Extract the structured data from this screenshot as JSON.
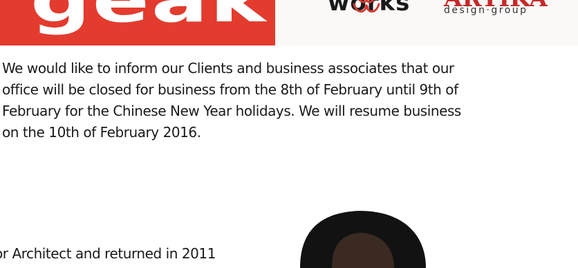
{
  "banner": {
    "left_text": "geak",
    "right_logo_text": "works",
    "right_logo_brand": "ARTIKA",
    "right_logo_subtitle": "design·group",
    "colors": {
      "left_bg": "#e33b2e",
      "right_bg": "#fbf9f7",
      "brand_red": "#c62a2a"
    }
  },
  "notice": {
    "lines": [
      "We would like to inform our Clients and business associates that our",
      "office will be closed for business from the 8th of February until 9th of",
      "February for the Chinese New Year holidays. We will resume business",
      "on the 10th of February 2016."
    ]
  },
  "bio": {
    "fragment": "or Architect and returned in 2011"
  },
  "icons": {
    "ornament": "flower-ornament-icon",
    "portrait": "portrait-photo"
  }
}
